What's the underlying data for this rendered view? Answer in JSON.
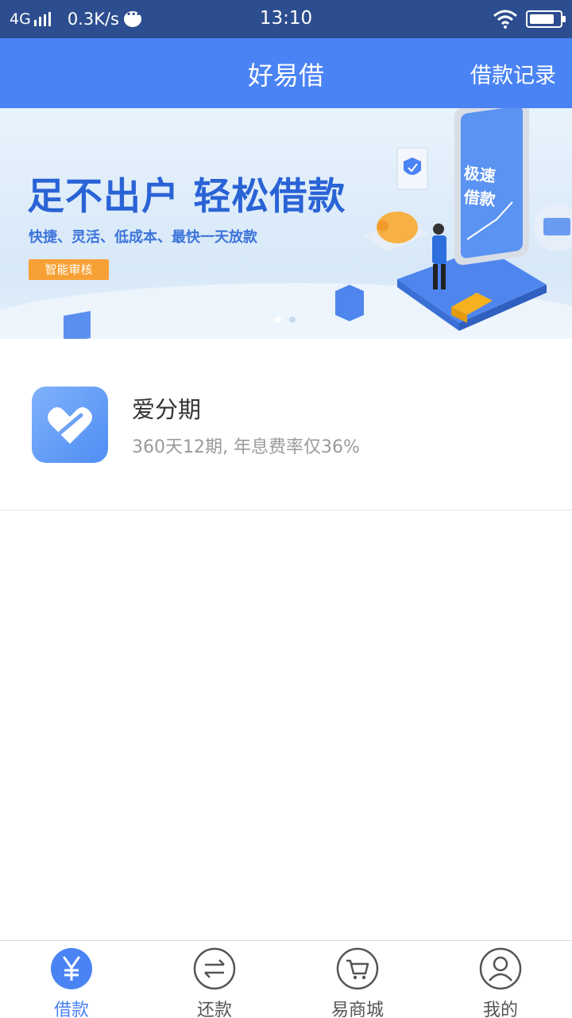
{
  "status_bar": {
    "network": "4G",
    "speed": "0.3K/s",
    "time": "13:10"
  },
  "header": {
    "title": "好易借",
    "right_link": "借款记录"
  },
  "banner": {
    "headline": "足不出户 轻松借款",
    "subtitle": "快捷、灵活、低成本、最快一天放款",
    "badge": "智能审核",
    "phone_text_line1": "极速",
    "phone_text_line2": "借款",
    "active_slide": 1,
    "slide_count": 2
  },
  "product": {
    "name": "爱分期",
    "description": "360天12期, 年息费率仅36%",
    "icon": "heart-icon"
  },
  "tabs": [
    {
      "label": "借款",
      "icon": "yen-icon",
      "active": true
    },
    {
      "label": "还款",
      "icon": "transfer-icon",
      "active": false
    },
    {
      "label": "易商城",
      "icon": "cart-icon",
      "active": false
    },
    {
      "label": "我的",
      "icon": "user-icon",
      "active": false
    }
  ],
  "colors": {
    "status_bar": "#2c4d8f",
    "header": "#4a83f4",
    "accent": "#4a83f4",
    "badge": "#f7a033"
  }
}
